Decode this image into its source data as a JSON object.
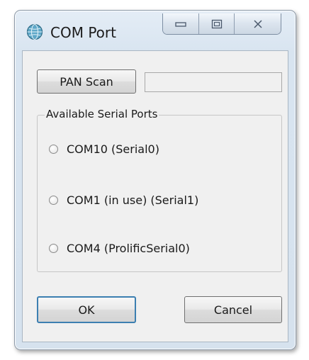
{
  "window": {
    "title": "COM Port",
    "caption_buttons": {
      "minimize": "minimize",
      "maximize": "maximize",
      "close": "close"
    }
  },
  "scan": {
    "button_label": "PAN Scan",
    "field_value": ""
  },
  "ports_group": {
    "label": "Available Serial Ports",
    "options": [
      {
        "label": "COM10 (Serial0)",
        "selected": false
      },
      {
        "label": "COM1 (in use) (Serial1)",
        "selected": false
      },
      {
        "label": "COM4 (ProlificSerial0)",
        "selected": false
      }
    ]
  },
  "actions": {
    "ok_label": "OK",
    "cancel_label": "Cancel"
  },
  "colors": {
    "accent": "#3c7fb1",
    "frame": "#d8e4f0",
    "client": "#f0f0f0"
  },
  "icons": {
    "app": "globe-icon",
    "minimize": "minimize-icon",
    "maximize": "maximize-icon",
    "close": "close-icon"
  }
}
